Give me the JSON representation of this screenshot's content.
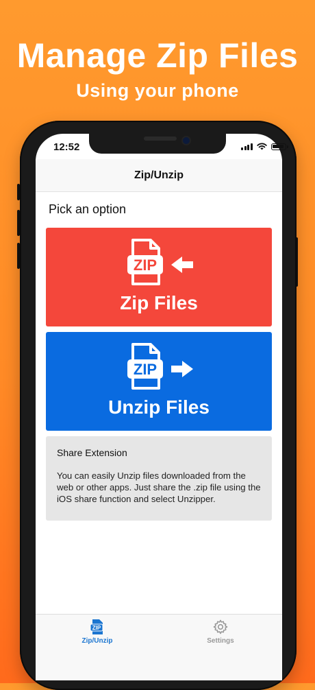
{
  "promo": {
    "headline": "Manage Zip Files",
    "subheadline": "Using your phone"
  },
  "status_bar": {
    "time": "12:52",
    "icons": [
      "cellular-signal-icon",
      "wifi-icon",
      "battery-icon"
    ]
  },
  "navbar": {
    "title": "Zip/Unzip"
  },
  "main": {
    "prompt": "Pick an option",
    "zip_card": {
      "label": "Zip Files",
      "icon_text": "ZIP",
      "icon": "zip-file-arrow-in-icon",
      "color": "#f4473b"
    },
    "unzip_card": {
      "label": "Unzip Files",
      "icon_text": "ZIP",
      "icon": "zip-file-arrow-out-icon",
      "color": "#0a6be0"
    },
    "share_info": {
      "title": "Share Extension",
      "body": "You can easily Unzip files downloaded from the web or other apps. Just share the .zip file using the iOS share function and select Unzipper."
    }
  },
  "tabbar": {
    "tabs": [
      {
        "label": "Zip/Unzip",
        "icon": "zip-file-icon",
        "active": true,
        "icon_text": "ZIP"
      },
      {
        "label": "Settings",
        "icon": "gear-icon",
        "active": false
      }
    ],
    "active_color": "#1b75d0"
  },
  "colors": {
    "background_top": "#ff9a2e",
    "background_bottom": "#ff6a1c"
  }
}
